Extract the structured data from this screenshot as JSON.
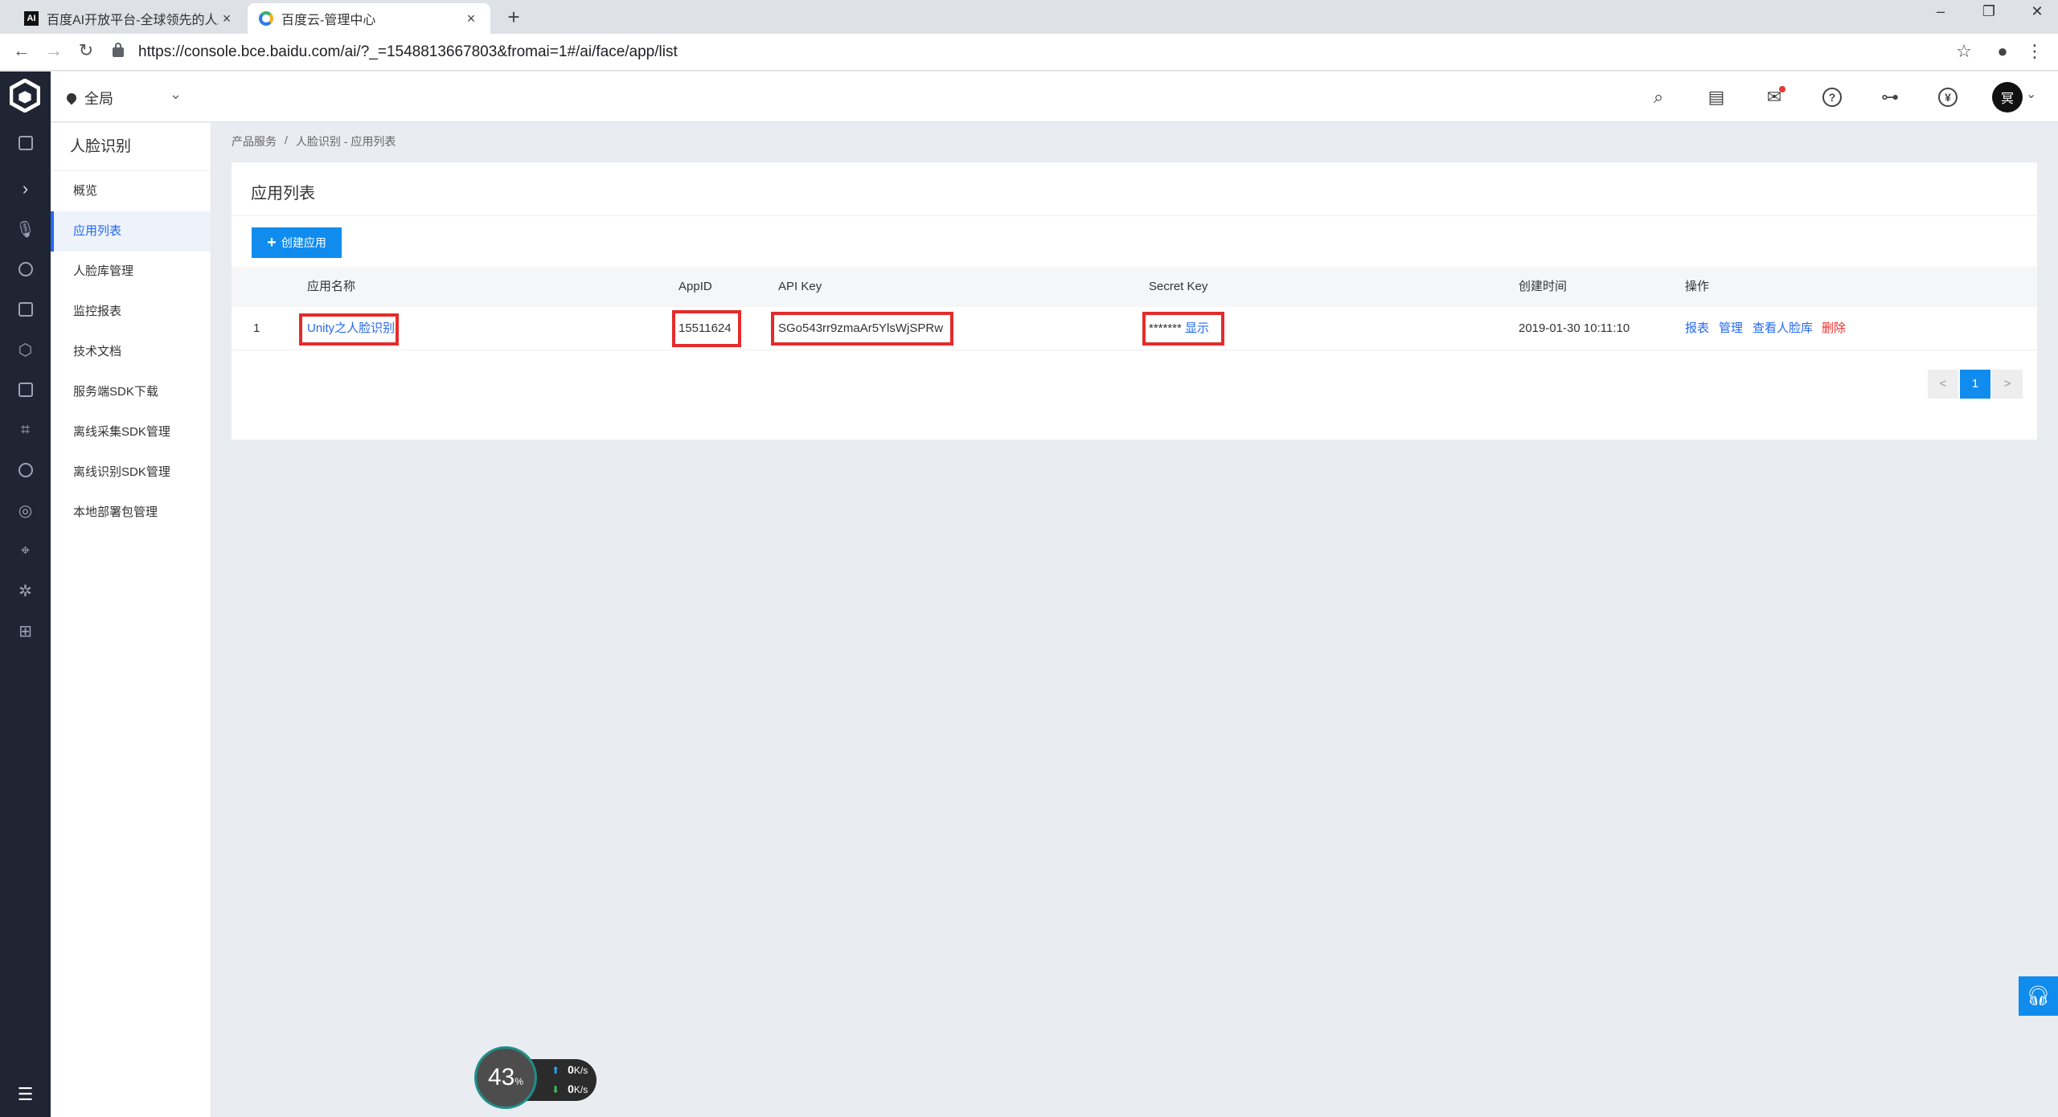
{
  "browser": {
    "tabs": [
      {
        "title": "百度AI开放平台-全球领先的人工",
        "favicon": "ai-icon"
      },
      {
        "title": "百度云-管理中心",
        "favicon": "baidu-cloud-icon"
      }
    ],
    "url": "https://console.bce.baidu.com/ai/?_=1548813667803&fromai=1#/ai/face/app/list"
  },
  "header": {
    "region": "全局",
    "avatar_text": "冥",
    "icons": [
      "search-icon",
      "document-icon",
      "message-icon",
      "help-icon",
      "org-icon",
      "yuan-icon"
    ]
  },
  "sidebar": {
    "title": "人脸识别",
    "items": [
      {
        "label": "概览",
        "active": false
      },
      {
        "label": "应用列表",
        "active": true
      },
      {
        "label": "人脸库管理",
        "active": false
      },
      {
        "label": "监控报表",
        "active": false
      },
      {
        "label": "技术文档",
        "active": false
      },
      {
        "label": "服务端SDK下载",
        "active": false
      },
      {
        "label": "离线采集SDK管理",
        "active": false
      },
      {
        "label": "离线识别SDK管理",
        "active": false
      },
      {
        "label": "本地部署包管理",
        "active": false
      }
    ]
  },
  "breadcrumb": {
    "root": "产品服务",
    "separator": "/",
    "current": "人脸识别 - 应用列表"
  },
  "panel": {
    "title": "应用列表",
    "create_button": "创建应用"
  },
  "table": {
    "columns": [
      "应用名称",
      "AppID",
      "API Key",
      "Secret Key",
      "创建时间",
      "操作"
    ],
    "rows": [
      {
        "index": "1",
        "name": "Unity之人脸识别",
        "app_id": "15511624",
        "api_key": "SGo543rr9zmaAr5YlsWjSPRw",
        "secret_mask": "*******",
        "secret_show": "显示",
        "created": "2019-01-30 10:11:10",
        "actions": {
          "report": "报表",
          "manage": "管理",
          "view_faces": "查看人脸库",
          "delete": "删除"
        }
      }
    ]
  },
  "pagination": {
    "prev": "<",
    "current": "1",
    "next": ">"
  },
  "speed_widget": {
    "percent": "43",
    "percent_unit": "%",
    "up": "0",
    "down": "0",
    "unit": "K/s"
  },
  "colors": {
    "accent": "#108cee",
    "link": "#2468f2",
    "danger": "#ea2e2e",
    "highlight_box": "#e52b2b",
    "dark_nav": "#1f2533"
  }
}
